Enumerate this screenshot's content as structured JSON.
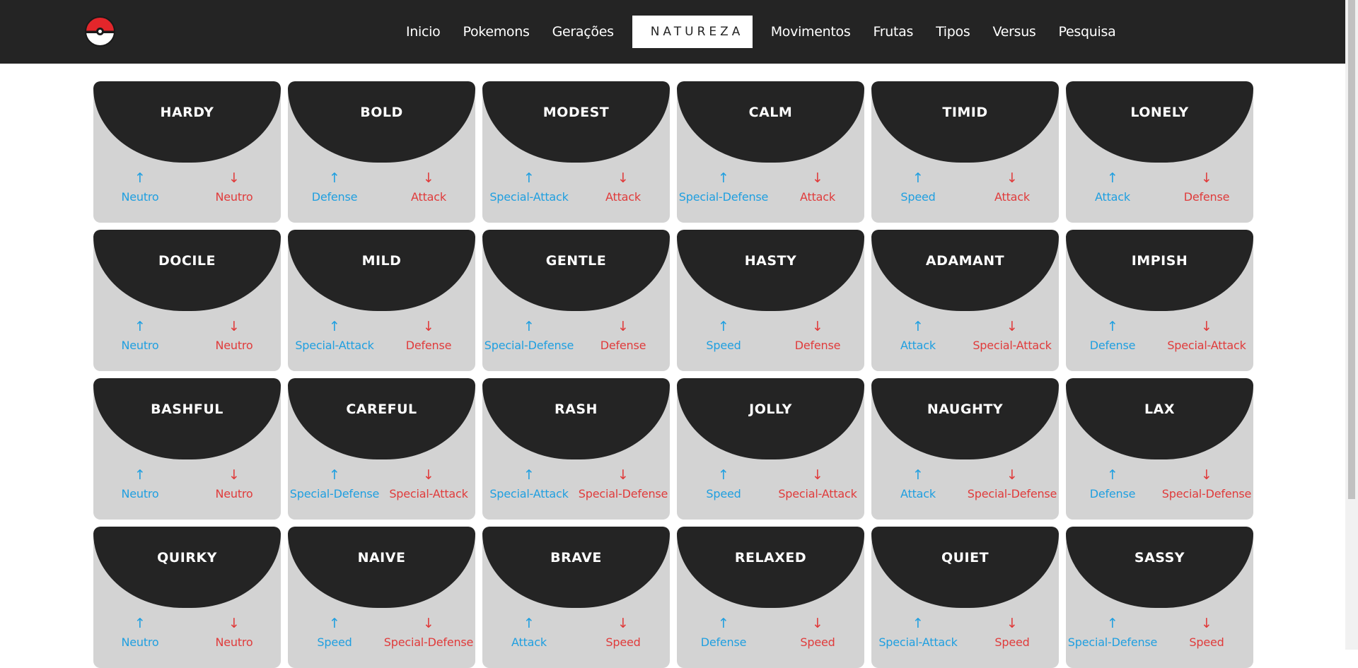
{
  "nav": {
    "items": [
      "Inicio",
      "Pokemons",
      "Gerações",
      "NATUREZA",
      "Movimentos",
      "Frutas",
      "Tipos",
      "Versus",
      "Pesquisa"
    ],
    "active": "NATUREZA"
  },
  "icons": {
    "up": "↑",
    "down": "↓"
  },
  "colors": {
    "increase": "#1f9fe0",
    "decrease": "#e03b3b",
    "header": "#242424",
    "card": "#d3d3d3"
  },
  "natures": [
    {
      "name": "HARDY",
      "up": "Neutro",
      "down": "Neutro"
    },
    {
      "name": "BOLD",
      "up": "Defense",
      "down": "Attack"
    },
    {
      "name": "MODEST",
      "up": "Special-Attack",
      "down": "Attack"
    },
    {
      "name": "CALM",
      "up": "Special-Defense",
      "down": "Attack"
    },
    {
      "name": "TIMID",
      "up": "Speed",
      "down": "Attack"
    },
    {
      "name": "LONELY",
      "up": "Attack",
      "down": "Defense"
    },
    {
      "name": "DOCILE",
      "up": "Neutro",
      "down": "Neutro"
    },
    {
      "name": "MILD",
      "up": "Special-Attack",
      "down": "Defense"
    },
    {
      "name": "GENTLE",
      "up": "Special-Defense",
      "down": "Defense"
    },
    {
      "name": "HASTY",
      "up": "Speed",
      "down": "Defense"
    },
    {
      "name": "ADAMANT",
      "up": "Attack",
      "down": "Special-Attack"
    },
    {
      "name": "IMPISH",
      "up": "Defense",
      "down": "Special-Attack"
    },
    {
      "name": "BASHFUL",
      "up": "Neutro",
      "down": "Neutro"
    },
    {
      "name": "CAREFUL",
      "up": "Special-Defense",
      "down": "Special-Attack"
    },
    {
      "name": "RASH",
      "up": "Special-Attack",
      "down": "Special-Defense"
    },
    {
      "name": "JOLLY",
      "up": "Speed",
      "down": "Special-Attack"
    },
    {
      "name": "NAUGHTY",
      "up": "Attack",
      "down": "Special-Defense"
    },
    {
      "name": "LAX",
      "up": "Defense",
      "down": "Special-Defense"
    },
    {
      "name": "QUIRKY",
      "up": "Neutro",
      "down": "Neutro"
    },
    {
      "name": "NAIVE",
      "up": "Speed",
      "down": "Special-Defense"
    },
    {
      "name": "BRAVE",
      "up": "Attack",
      "down": "Speed"
    },
    {
      "name": "RELAXED",
      "up": "Defense",
      "down": "Speed"
    },
    {
      "name": "QUIET",
      "up": "Special-Attack",
      "down": "Speed"
    },
    {
      "name": "SASSY",
      "up": "Special-Defense",
      "down": "Speed"
    }
  ]
}
